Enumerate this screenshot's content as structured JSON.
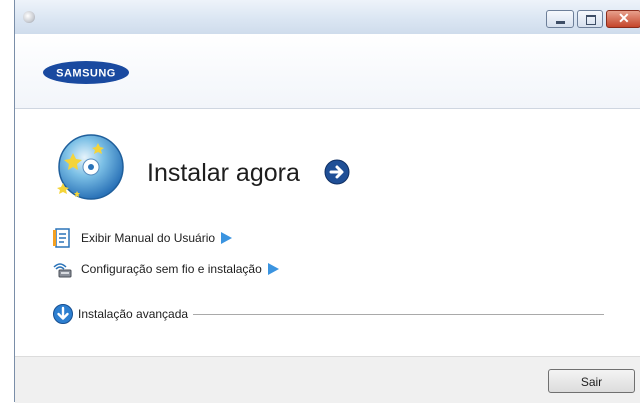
{
  "window": {
    "title": "",
    "controls": {
      "minimize_icon": "minimize-icon",
      "maximize_icon": "maximize-icon",
      "close_icon": "close-icon"
    }
  },
  "header": {
    "logo_text": "SAMSUNG"
  },
  "main": {
    "install_now_label": "Instalar agora",
    "install_now_icon": "arrow-right-circle-icon",
    "links": [
      {
        "label": "Exibir Manual do Usuário",
        "icon": "manual-book-icon"
      },
      {
        "label": "Configuração sem fio e instalação",
        "icon": "wireless-icon"
      }
    ],
    "advanced": {
      "label": "Instalação avançada",
      "icon": "chevron-down-circle-icon"
    }
  },
  "footer": {
    "exit_label": "Sair"
  },
  "colors": {
    "accent_blue": "#3b94e0",
    "logo_blue": "#1a4aa0"
  }
}
